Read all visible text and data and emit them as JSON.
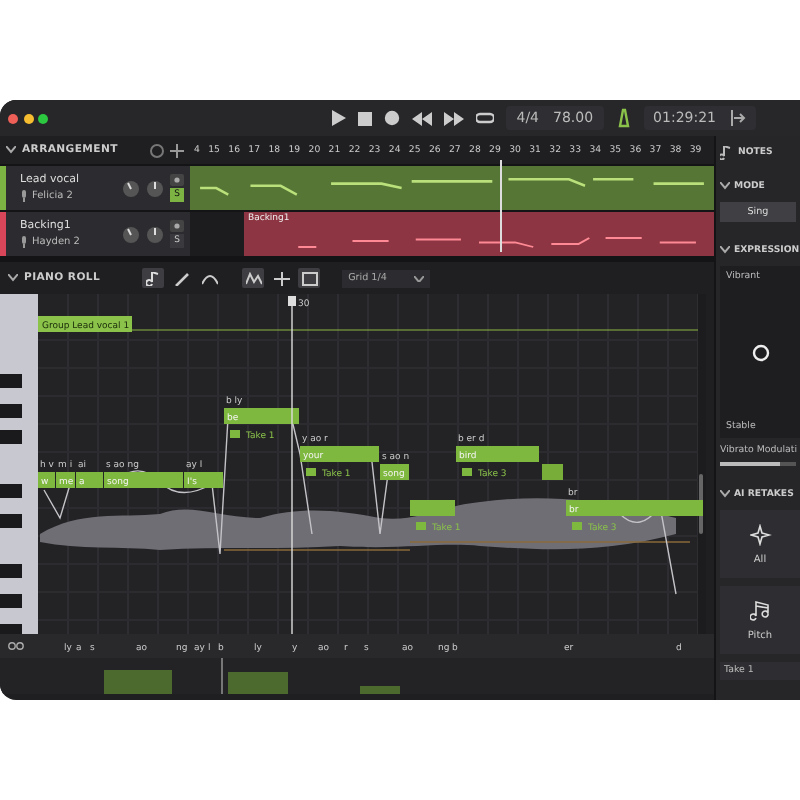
{
  "toolbar": {
    "time_signature": "4/4",
    "tempo": "78.00",
    "timecode": "01:29:21"
  },
  "arrangement": {
    "title": "ARRANGEMENT",
    "ruler": [
      "4",
      "15",
      "16",
      "17",
      "18",
      "19",
      "20",
      "21",
      "22",
      "23",
      "24",
      "25",
      "26",
      "27",
      "28",
      "29",
      "30",
      "31",
      "32",
      "33",
      "34",
      "35",
      "36",
      "37",
      "38",
      "39"
    ],
    "tracks": [
      {
        "name": "Lead vocal",
        "singer": "Felicia 2",
        "solo_label": "S",
        "solo": true,
        "color": "#7cb342"
      },
      {
        "name": "Backing1",
        "singer": "Hayden 2",
        "solo_label": "S",
        "solo": false,
        "color": "#d9465a",
        "region_label": "Backing1"
      }
    ]
  },
  "piano_roll": {
    "title": "PIANO ROLL",
    "tools": [
      {
        "kind": "note",
        "selected": true
      },
      {
        "kind": "pencil",
        "selected": false
      },
      {
        "kind": "curve",
        "selected": false
      },
      {
        "kind": "pitch",
        "selected": true
      },
      {
        "kind": "split",
        "selected": false
      },
      {
        "kind": "panel",
        "selected": true
      }
    ],
    "grid": "Grid 1/4",
    "playhead": "30",
    "group": "Group Lead vocal 1",
    "notes": [
      {
        "phonemes": "h v",
        "text": "w"
      },
      {
        "phonemes": "m i",
        "text": "me"
      },
      {
        "phonemes": "ai",
        "text": "a"
      },
      {
        "phonemes": "s ao ng",
        "text": "song"
      },
      {
        "phonemes": "ay l",
        "text": "I's"
      },
      {
        "phonemes": "b ly",
        "text": "be",
        "take": "Take 1"
      },
      {
        "phonemes": "y ao r",
        "text": "your",
        "take": "Take 1"
      },
      {
        "phonemes": "s ao n",
        "text": "song"
      },
      {
        "phonemes": "b er d",
        "text": "bird",
        "take": "Take 3"
      },
      {
        "kind": "short"
      },
      {
        "take": "Take 1"
      },
      {
        "phonemes": "br",
        "text": "br",
        "take": "Take 3"
      }
    ],
    "phonemes": [
      "ly",
      "a",
      "s",
      "ao",
      "ng",
      "ay",
      "l",
      "b",
      "ly",
      "y",
      "ao",
      "r",
      "s",
      "ao",
      "ng",
      "b",
      "er",
      "d"
    ]
  },
  "panel": {
    "title": "NOTES",
    "mode_title": "MODE",
    "modes": [
      {
        "label": "Sing",
        "selected": true
      }
    ],
    "expression_title": "EXPRESSION",
    "vibrant": "Vibrant",
    "stable": "Stable",
    "modulation": {
      "label": "Vibrato Modulati",
      "level": 0.8
    },
    "retakes_title": "AI RETAKES",
    "retakes": [
      {
        "kind": "all",
        "label": "All"
      },
      {
        "kind": "pitch",
        "label": "Pitch"
      }
    ],
    "take": "Take 1"
  }
}
